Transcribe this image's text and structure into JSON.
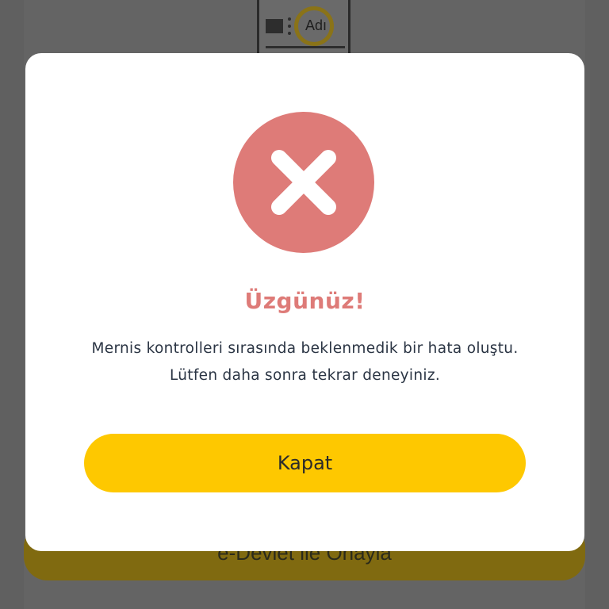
{
  "background": {
    "card_illustration_label": "Adı",
    "edevlet_button_label": "e-Devlet ile Onayla"
  },
  "modal": {
    "icon": "error-x-icon",
    "icon_color": "#de7b78",
    "title": "Üzgünüz!",
    "message": "Mernis kontrolleri sırasında beklenmedik bir hata oluştu. Lütfen daha sonra tekrar deneyiniz.",
    "close_label": "Kapat",
    "button_color": "#fec800"
  }
}
